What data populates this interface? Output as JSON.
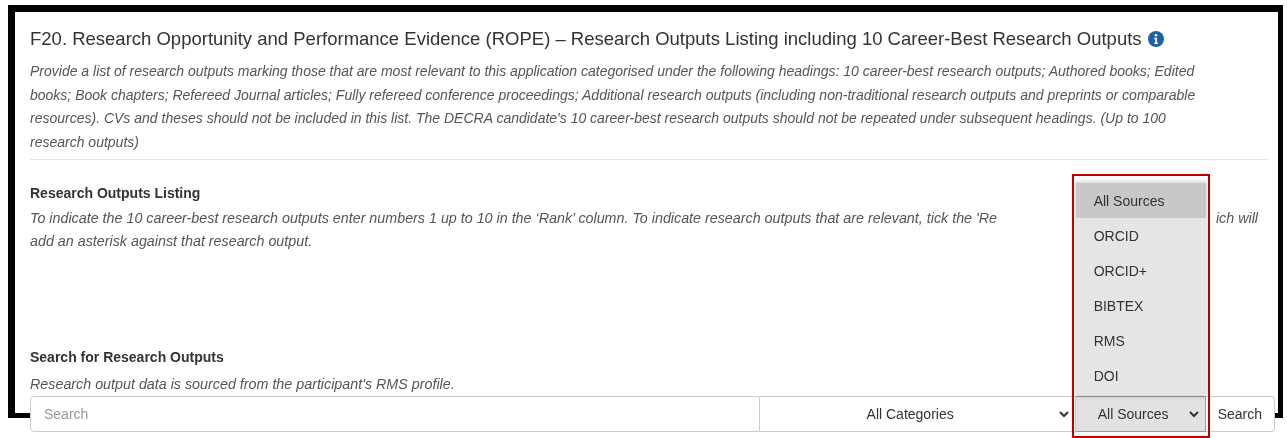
{
  "section": {
    "title": "F20. Research Opportunity and Performance Evidence (ROPE) – Research Outputs Listing including 10 Career-Best Research Outputs",
    "description": "Provide a list of research outputs marking those that are most relevant to this application categorised under the following headings: 10 career-best research outputs; Authored books; Edited books; Book chapters; Refereed Journal articles; Fully refereed conference proceedings; Additional research outputs (including non-traditional research outputs and preprints or comparable resources). CVs and theses should not be included in this list. The DECRA candidate's 10 career-best research outputs should not be repeated under subsequent headings. (Up to 100 research outputs)"
  },
  "listing": {
    "heading": "Research Outputs Listing",
    "instruction_start": "To indicate the 10 career-best research outputs enter numbers 1 up to 10 in the ‘Rank’ column. To indicate research outputs that are relevant, tick the 'Re",
    "instruction_end": "ich will",
    "instruction_line_2": "add an asterisk against that research output."
  },
  "search": {
    "heading": "Search for Research Outputs",
    "note": "Research output data is sourced from the participant's RMS profile.",
    "placeholder": "Search",
    "category_select": "All Categories",
    "source_select": "All Sources",
    "button": "Search",
    "source_options": [
      {
        "label": "All Sources",
        "selected": true
      },
      {
        "label": "ORCID",
        "selected": false
      },
      {
        "label": "ORCID+",
        "selected": false
      },
      {
        "label": "BIBTEX",
        "selected": false
      },
      {
        "label": "RMS",
        "selected": false
      },
      {
        "label": "DOI",
        "selected": false
      }
    ]
  }
}
